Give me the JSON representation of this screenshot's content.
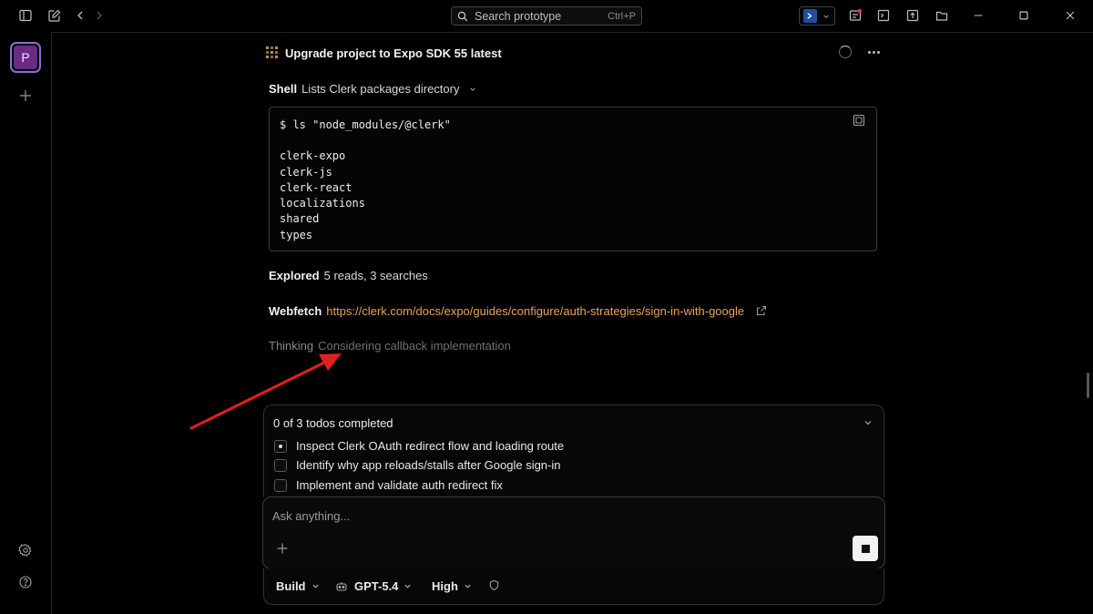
{
  "search": {
    "placeholder": "Search prototype",
    "shortcut": "Ctrl+P"
  },
  "sidebar": {
    "project_initial": "P"
  },
  "header": {
    "title": "Upgrade project to Expo SDK 55 latest"
  },
  "shell": {
    "label": "Shell",
    "description": "Lists Clerk packages directory",
    "command": "$ ls \"node_modules/@clerk\"",
    "output": [
      "clerk-expo",
      "clerk-js",
      "clerk-react",
      "localizations",
      "shared",
      "types"
    ]
  },
  "explored": {
    "label": "Explored",
    "value": "5 reads, 3 searches"
  },
  "webfetch": {
    "label": "Webfetch",
    "url": "https://clerk.com/docs/expo/guides/configure/auth-strategies/sign-in-with-google"
  },
  "thinking": {
    "label": "Thinking",
    "value": "Considering callback implementation"
  },
  "todos": {
    "summary": "0 of 3 todos completed",
    "items": [
      {
        "label": "Inspect Clerk OAuth redirect flow and loading route",
        "status": "in_progress"
      },
      {
        "label": "Identify why app reloads/stalls after Google sign-in",
        "status": "pending"
      },
      {
        "label": "Implement and validate auth redirect fix",
        "status": "pending"
      }
    ]
  },
  "composer": {
    "placeholder": "Ask anything..."
  },
  "toolbar": {
    "mode": "Build",
    "model": "GPT-5.4",
    "effort": "High"
  },
  "colors": {
    "accent_link": "#e8a35c",
    "annotation_arrow": "#e02020",
    "avatar": "#6a2a86"
  }
}
